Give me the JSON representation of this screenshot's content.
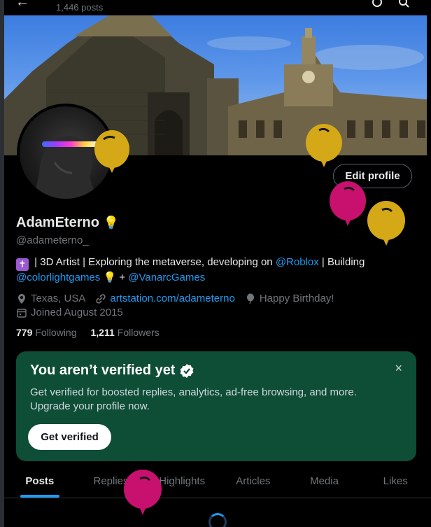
{
  "topbar": {
    "posts_count": "1,446 posts",
    "back_icon": "arrow-left-icon"
  },
  "profile": {
    "name": "AdamEterno",
    "name_emoji": "💡",
    "handle": "@adameterno_",
    "bio_parts": {
      "cross": "✝",
      "text1": " | 3D Artist | Exploring the metaverse, developing on ",
      "link1": "@Roblox",
      "text2": " | Building ",
      "link2": "@colorlightgames",
      "bulb": " 💡",
      "text3": " + ",
      "link3": "@VanarcGames"
    },
    "location": "Texas, USA",
    "website": "artstation.com/adameterno",
    "birthday": "Happy Birthday!",
    "joined": "Joined August 2015",
    "following_count": "779",
    "following_label": "Following",
    "followers_count": "1,211",
    "followers_label": "Followers",
    "edit_button": "Edit profile"
  },
  "verify_card": {
    "title": "You aren’t verified yet",
    "description": "Get verified for boosted replies, analytics, ad-free browsing, and more. Upgrade your profile now.",
    "button": "Get verified",
    "close": "×"
  },
  "tabs": [
    "Posts",
    "Replies",
    "Highlights",
    "Articles",
    "Media",
    "Likes"
  ],
  "active_tab": "Posts",
  "colors": {
    "accent": "#1d9bf0",
    "card": "#0e4d36",
    "balloon_yellow": "#d4a816",
    "balloon_pink": "#c8106e"
  }
}
